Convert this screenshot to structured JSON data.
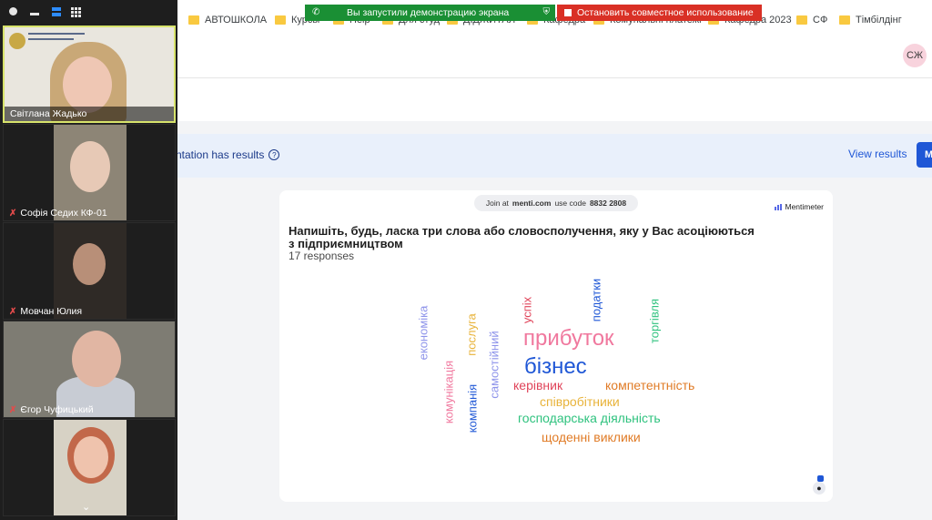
{
  "browser": {
    "bookmarks": [
      {
        "label": "АВТОШКОЛА",
        "icon": "folder-icon"
      },
      {
        "label": "Курсы",
        "icon": "folder-icon"
      },
      {
        "label": "Help",
        "icon": "folder-icon"
      },
      {
        "label": "Для студ",
        "icon": "folder-icon"
      },
      {
        "label": "ДІДЖИТАЛ",
        "icon": "folder-icon"
      },
      {
        "label": "Кафедра",
        "icon": "folder-icon"
      },
      {
        "label": "Комунальні платежі",
        "icon": "folder-icon"
      },
      {
        "label": "Кафедра 2023",
        "icon": "folder-icon"
      },
      {
        "label": "СФ",
        "icon": "folder-icon"
      },
      {
        "label": "Тімбілдінг",
        "icon": "folder-icon"
      }
    ]
  },
  "screen_share": {
    "status": "Вы запустили демонстрацию экрана",
    "stop_label": "Остановить совместное использование",
    "colors": {
      "status_bg": "#1a8f34",
      "stop_bg": "#d93025"
    }
  },
  "page": {
    "avatar_initials": "СЖ",
    "results_text": "ntation has results",
    "view_results": "View results",
    "primary_button": "M"
  },
  "slide": {
    "join_prefix": "Join at",
    "join_site": "menti.com",
    "join_code_label": "use code",
    "join_code": "8832 2808",
    "brand": "Mentimeter",
    "question": "Напишіть, будь, ласка три слова або словосполучення, яку у Вас асоціюються з підприємництвом",
    "responses": "17 responses",
    "words": [
      {
        "text": "прибуток",
        "color": "#f0789e"
      },
      {
        "text": "бізнес",
        "color": "#1f57d6"
      },
      {
        "text": "компетентність",
        "color": "#e07b26"
      },
      {
        "text": "керівник",
        "color": "#e0445a"
      },
      {
        "text": "співробітники",
        "color": "#e8b33a"
      },
      {
        "text": "господарська діяльність",
        "color": "#2ec27e"
      },
      {
        "text": "щоденні виклики",
        "color": "#e07b26"
      },
      {
        "text": "економіка",
        "color": "#8d93ea"
      },
      {
        "text": "комунікація",
        "color": "#f0789e"
      },
      {
        "text": "послуга",
        "color": "#e8b33a"
      },
      {
        "text": "компанія",
        "color": "#1f57d6"
      },
      {
        "text": "самостійний",
        "color": "#8d93ea"
      },
      {
        "text": "успіх",
        "color": "#e0445a"
      },
      {
        "text": "податки",
        "color": "#1f57d6"
      },
      {
        "text": "торгівля",
        "color": "#2ec27e"
      }
    ]
  },
  "participants": [
    {
      "name": "Світлана Жадько",
      "muted": false,
      "active": true
    },
    {
      "name": "Софія Седих КФ-01",
      "muted": true,
      "active": false
    },
    {
      "name": "Мовчан Юлия",
      "muted": true,
      "active": false
    },
    {
      "name": "Єгор Чуфицький",
      "muted": true,
      "active": false
    }
  ],
  "colors": {
    "accent": "#1f57d6",
    "panel_bg": "#1e1e1e",
    "results_bar": "#e9f0fb"
  }
}
